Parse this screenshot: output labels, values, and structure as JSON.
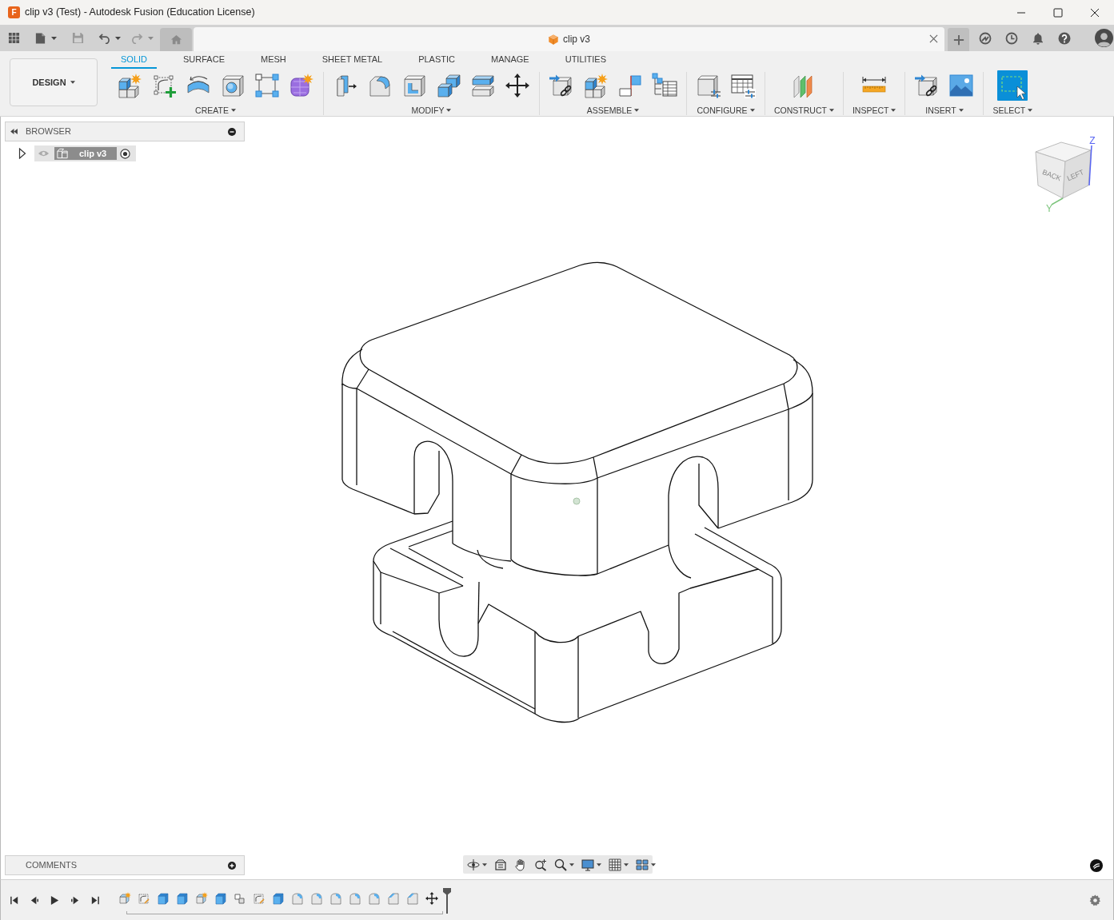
{
  "window": {
    "app_icon_letter": "F",
    "title": "clip v3 (Test) - Autodesk Fusion (Education License)"
  },
  "document_tab": {
    "title": "clip v3"
  },
  "workspace_menu": {
    "label": "DESIGN"
  },
  "toolbar_tabs": [
    {
      "label": "SOLID",
      "selected": true
    },
    {
      "label": "SURFACE",
      "selected": false
    },
    {
      "label": "MESH",
      "selected": false
    },
    {
      "label": "SHEET METAL",
      "selected": false
    },
    {
      "label": "PLASTIC",
      "selected": false
    },
    {
      "label": "MANAGE",
      "selected": false
    },
    {
      "label": "UTILITIES",
      "selected": false
    }
  ],
  "tool_groups": [
    {
      "label": "CREATE"
    },
    {
      "label": "MODIFY"
    },
    {
      "label": "ASSEMBLE"
    },
    {
      "label": "CONFIGURE"
    },
    {
      "label": "CONSTRUCT"
    },
    {
      "label": "INSPECT"
    },
    {
      "label": "INSERT"
    },
    {
      "label": "SELECT"
    }
  ],
  "browser": {
    "title": "BROWSER",
    "items": [
      {
        "label": "clip v3",
        "expanded": false,
        "active": true
      }
    ]
  },
  "view_cube": {
    "faces": [
      "BACK",
      "LEFT"
    ],
    "axes": [
      {
        "label": "Z",
        "color": "#5865f2"
      },
      {
        "label": "Y",
        "color": "#7bc47b"
      }
    ]
  },
  "comments": {
    "title": "COMMENTS"
  }
}
